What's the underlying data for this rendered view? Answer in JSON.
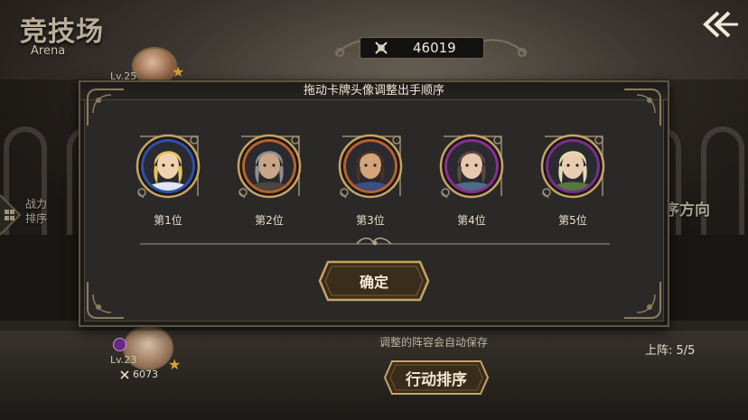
{
  "screen": {
    "title": "竞技场",
    "subtitle": "Arena",
    "currency_value": "46019",
    "top_level": "Lv.25",
    "side_button_label_line1": "战力",
    "side_button_label_line2": "排序",
    "direction_text": "序方向",
    "bottom_level": "Lv.23",
    "bottom_power": "6073",
    "autosave_note": "调整的阵容会自动保存",
    "deploy_count": "上阵: 5/5",
    "action_button": "行动排序"
  },
  "modal": {
    "title": "拖动卡牌头像调整出手顺序",
    "confirm_label": "确定",
    "heroes": [
      {
        "position_label": "第1位",
        "ring_color": "#2f4fa8",
        "hair": "#e2c35b",
        "skin": "#f1d2b0",
        "cloth": "#dfe6f2"
      },
      {
        "position_label": "第2位",
        "ring_color": "#b8612b",
        "hair": "#8e8f92",
        "skin": "#c9a587",
        "cloth": "#4a4640"
      },
      {
        "position_label": "第3位",
        "ring_color": "#b8612b",
        "hair": "#4a3322",
        "skin": "#d4a57c",
        "cloth": "#3b4f86"
      },
      {
        "position_label": "第4位",
        "ring_color": "#8a2f8f",
        "hair": "#5d4a3e",
        "skin": "#e6c7b0",
        "cloth": "#4f6b8c"
      },
      {
        "position_label": "第5位",
        "ring_color": "#7a2f8a",
        "hair": "#e4dcae",
        "skin": "#e9cdb3",
        "cloth": "#56783f"
      }
    ]
  },
  "colors": {
    "gold": "#c8a463",
    "panel": "#2b2927",
    "button_fill": "#3b2d1c"
  }
}
